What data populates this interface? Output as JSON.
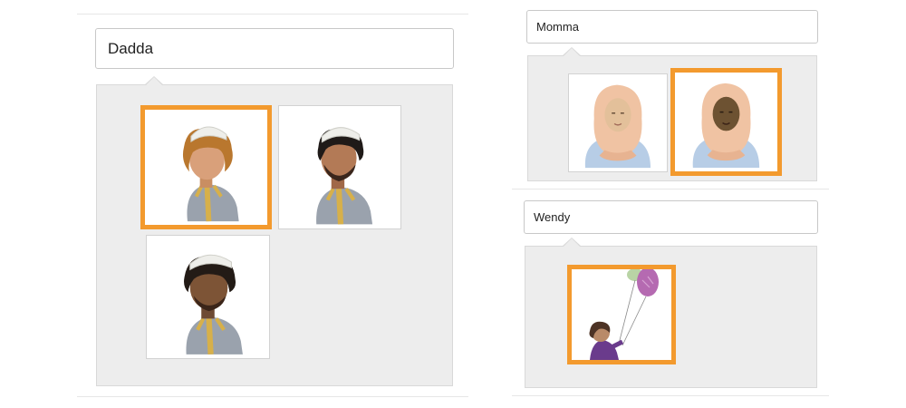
{
  "profiles": [
    {
      "name": "Dadda",
      "avatars": [
        {
          "icon": "man-avatar-light-icon",
          "selected": true
        },
        {
          "icon": "man-avatar-beard-icon",
          "selected": false
        },
        {
          "icon": "man-avatar-dark-icon",
          "selected": false
        }
      ]
    },
    {
      "name": "Momma",
      "avatars": [
        {
          "icon": "woman-hijab-light-icon",
          "selected": false
        },
        {
          "icon": "woman-hijab-dark-icon",
          "selected": true
        }
      ]
    },
    {
      "name": "Wendy",
      "avatars": [
        {
          "icon": "girl-with-balloons-icon",
          "selected": true
        }
      ]
    }
  ],
  "colors": {
    "selection": "#f39a2e",
    "panel": "#ededed",
    "field_border": "#c8c8c8"
  }
}
